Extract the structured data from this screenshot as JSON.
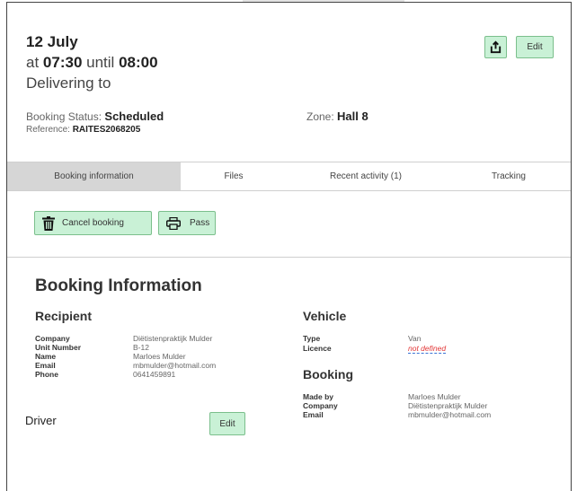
{
  "header": {
    "date": "12 July",
    "time_prefix": "at",
    "start_time": "07:30",
    "time_mid": "until",
    "end_time": "08:00",
    "delivering": "Delivering to",
    "status_label": "Booking Status:",
    "status_value": "Scheduled",
    "reference_label": "Reference:",
    "reference_value": "RAITES2068205",
    "zone_label": "Zone:",
    "zone_value": "Hall 8",
    "share_icon": "share-upload-icon",
    "edit_label": "Edit"
  },
  "tabs": [
    {
      "label": "Booking information",
      "active": true
    },
    {
      "label": "Files",
      "active": false
    },
    {
      "label": "Recent activity (1)",
      "active": false
    },
    {
      "label": "Tracking",
      "active": false
    }
  ],
  "actions": {
    "cancel_label": "Cancel booking",
    "cancel_icon": "trash-icon",
    "pass_label": "Pass",
    "pass_icon": "printer-icon"
  },
  "booking_info": {
    "title": "Booking Information",
    "recipient": {
      "title": "Recipient",
      "fields": [
        {
          "key": "Company",
          "value": "Diëtistenpraktijk Mulder"
        },
        {
          "key": "Unit Number",
          "value": "B-12"
        },
        {
          "key": "Name",
          "value": "Marloes Mulder"
        },
        {
          "key": "Email",
          "value": "mbmulder@hotmail.com"
        },
        {
          "key": "Phone",
          "value": "0641459891"
        }
      ]
    },
    "vehicle": {
      "title": "Vehicle",
      "fields": [
        {
          "key": "Type",
          "value": "Van"
        },
        {
          "key": "Licence",
          "value": "not defined"
        }
      ]
    },
    "booking": {
      "title": "Booking",
      "fields": [
        {
          "key": "Made by",
          "value": "Marloes Mulder"
        },
        {
          "key": "Company",
          "value": "Diëtistenpraktijk Mulder"
        },
        {
          "key": "Email",
          "value": "mbmulder@hotmail.com"
        }
      ]
    },
    "driver": {
      "label": "Driver",
      "edit_label": "Edit"
    }
  },
  "colors": {
    "button_green": "#c9f1d6",
    "button_border": "#7bbf8c",
    "tab_active": "#d6d6d6",
    "not_defined": "#e23636"
  }
}
